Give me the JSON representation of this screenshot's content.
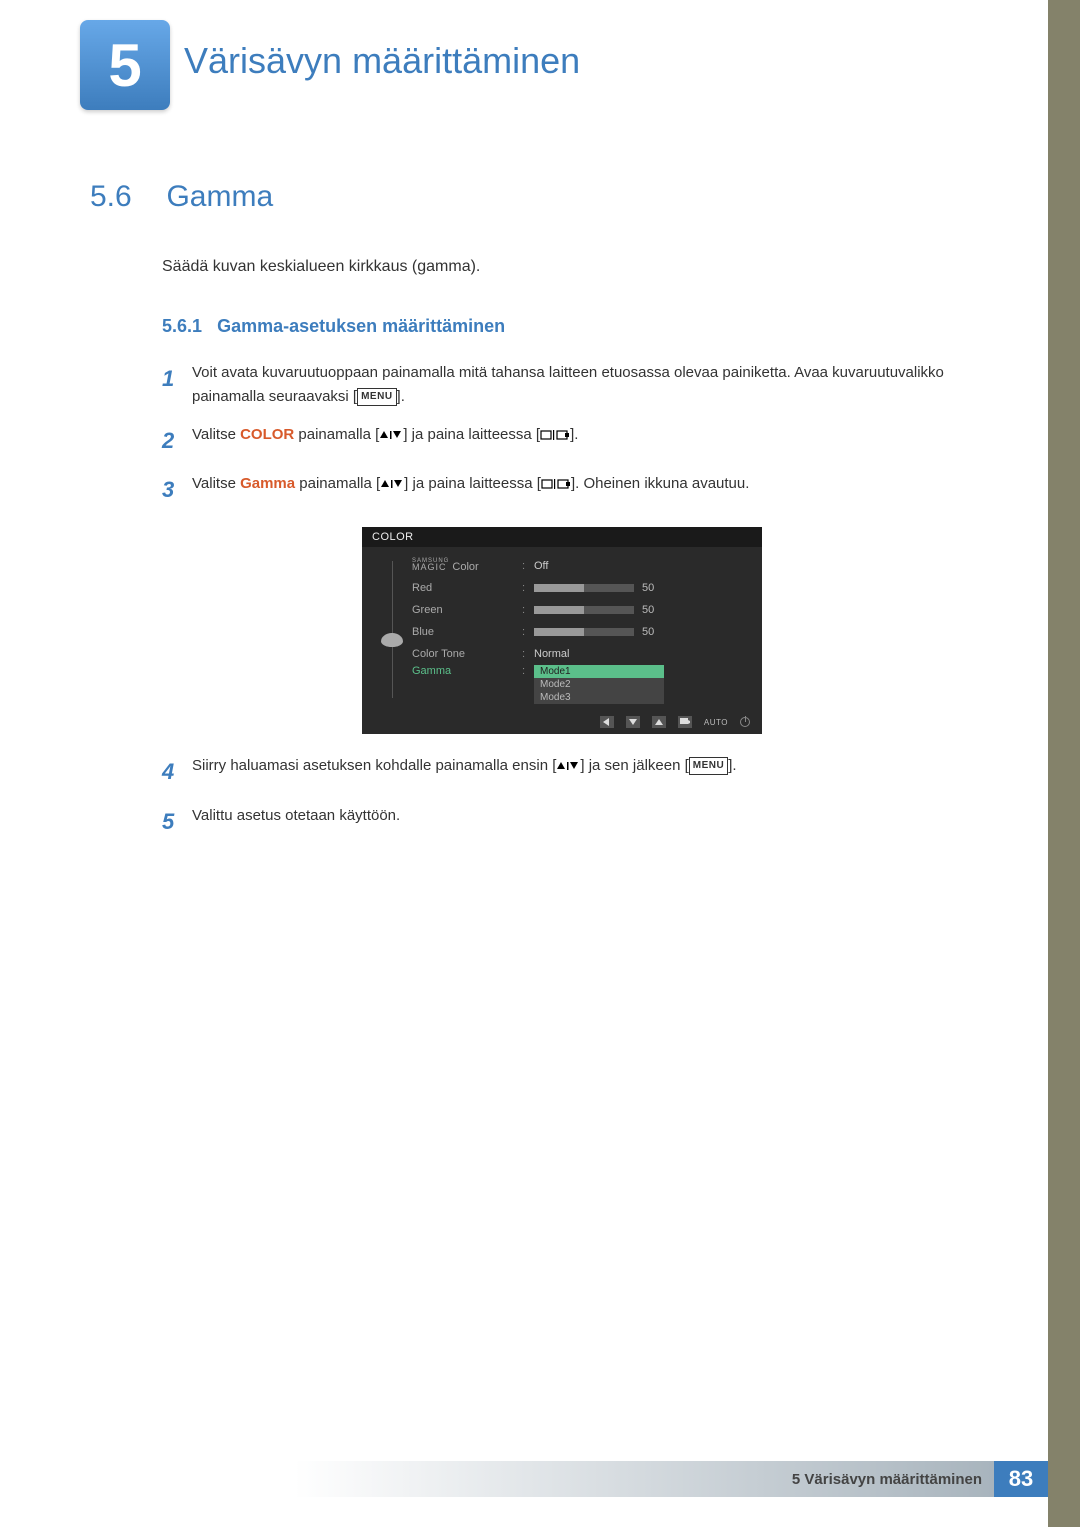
{
  "chapter": {
    "number": "5",
    "title": "Värisävyn määrittäminen"
  },
  "section": {
    "number": "5.6",
    "title": "Gamma"
  },
  "intro": "Säädä kuvan keskialueen kirkkaus (gamma).",
  "subsection": {
    "number": "5.6.1",
    "title": "Gamma-asetuksen määrittäminen"
  },
  "steps": {
    "s1": {
      "text_a": "Voit avata kuvaruutuoppaan painamalla mitä tahansa laitteen etuosassa olevaa painiketta. Avaa kuvaruutuvalikko painamalla seuraavaksi [",
      "menu": "MENU",
      "text_b": "]."
    },
    "s2": {
      "text_a": "Valitse ",
      "kw": "COLOR",
      "text_b": " painamalla [",
      "text_c": "] ja paina laitteessa [",
      "text_d": "]."
    },
    "s3": {
      "text_a": "Valitse ",
      "kw": "Gamma",
      "text_b": " painamalla [",
      "text_c": "] ja paina laitteessa [",
      "text_d": "]. Oheinen ikkuna avautuu."
    },
    "s4": {
      "text_a": "Siirry haluamasi asetuksen kohdalle painamalla ensin [",
      "text_b": "] ja sen jälkeen [",
      "menu": "MENU",
      "text_c": "]."
    },
    "s5": {
      "text": "Valittu asetus otetaan käyttöön."
    }
  },
  "osd": {
    "title": "COLOR",
    "magic_top": "SAMSUNG",
    "magic_bottom": "MAGIC",
    "magic_suffix": "Color",
    "magic_val": "Off",
    "red": {
      "label": "Red",
      "val": "50"
    },
    "green": {
      "label": "Green",
      "val": "50"
    },
    "blue": {
      "label": "Blue",
      "val": "50"
    },
    "tone": {
      "label": "Color Tone",
      "val": "Normal"
    },
    "gamma": {
      "label": "Gamma"
    },
    "modes": {
      "m1": "Mode1",
      "m2": "Mode2",
      "m3": "Mode3"
    },
    "auto": "AUTO"
  },
  "footer": {
    "text": "5 Värisävyn määrittäminen",
    "page": "83"
  }
}
